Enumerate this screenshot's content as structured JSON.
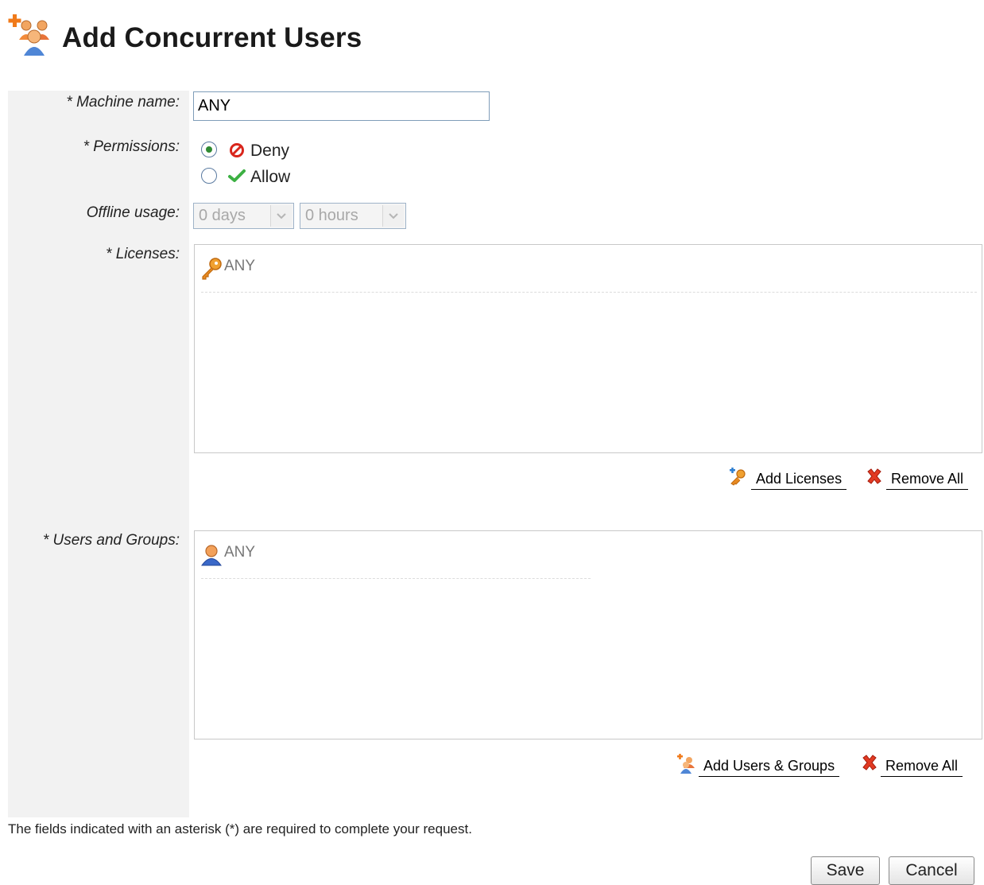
{
  "header": {
    "title": "Add Concurrent Users",
    "icon": "add-users-icon"
  },
  "form": {
    "machine_name": {
      "label": "* Machine name:",
      "value": "ANY"
    },
    "permissions": {
      "label": "* Permissions:",
      "options": [
        {
          "label": "Deny",
          "icon": "deny-icon",
          "selected": true,
          "color": "#d9261c"
        },
        {
          "label": "Allow",
          "icon": "check-icon",
          "selected": false,
          "color": "#3cb043"
        }
      ]
    },
    "offline_usage": {
      "label": "Offline usage:",
      "days": "0 days",
      "hours": "0 hours",
      "disabled": true
    },
    "licenses": {
      "label": "* Licenses:",
      "items": [
        {
          "label": "ANY",
          "icon": "key-icon"
        }
      ],
      "actions": {
        "add": "Add Licenses",
        "remove": "Remove All"
      }
    },
    "users_groups": {
      "label": "* Users and Groups:",
      "items": [
        {
          "label": "ANY",
          "icon": "user-icon"
        }
      ],
      "actions": {
        "add": "Add Users & Groups",
        "remove": "Remove All"
      }
    }
  },
  "footer": {
    "note": "The fields indicated with an asterisk (*) are required to complete your request.",
    "save": "Save",
    "cancel": "Cancel"
  }
}
